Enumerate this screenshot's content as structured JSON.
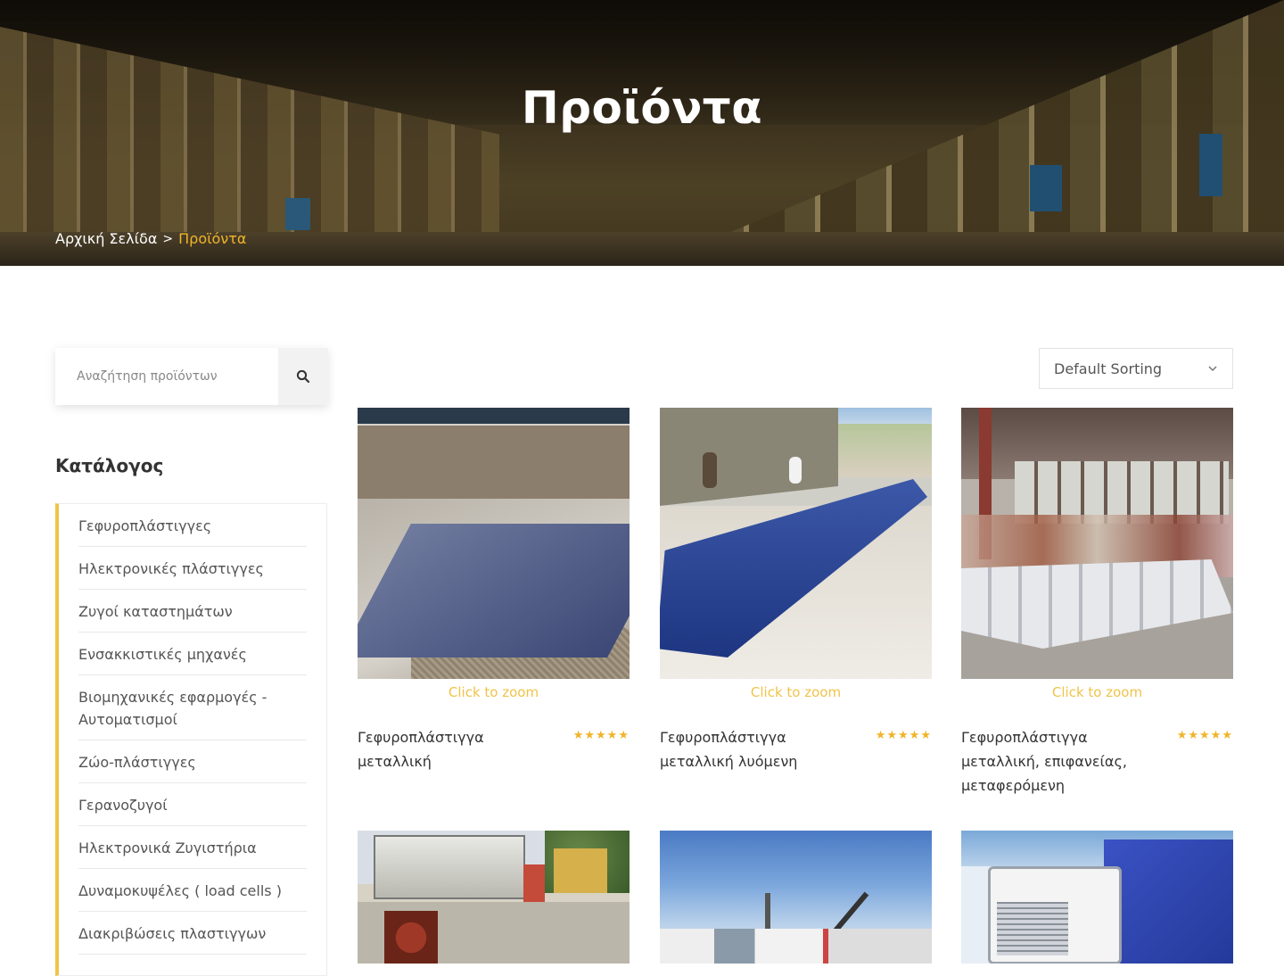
{
  "hero": {
    "title": "Προϊόντα",
    "breadcrumb": {
      "home": "Αρχική Σελίδα",
      "separator": ">",
      "current": "Προϊόντα"
    }
  },
  "search": {
    "placeholder": "Αναζήτηση προϊόντων",
    "icon": "search-icon"
  },
  "catalog": {
    "title": "Κατάλογος",
    "items": [
      "Γεφυροπλάστιγγες",
      "Ηλεκτρονικές πλάστιγγες",
      "Ζυγοί καταστημάτων",
      "Ενσακκιστικές μηχανές",
      "Βιομηχανικές εφαρμογές - Αυτοματισμοί",
      "Ζώο-πλάστιγγες",
      "Γερανοζυγοί",
      "Ηλεκτρονικά Ζυγιστήρια",
      "Δυναμοκυψέλες ( load cells )",
      "Διακριβώσεις πλαστιγγων"
    ]
  },
  "sort": {
    "selected": "Default Sorting",
    "icon": "chevron-down-icon"
  },
  "products": [
    {
      "zoom_label": "Click to zoom",
      "name": "Γεφυροπλάστιγγα μεταλλική",
      "rating": "★★★★★"
    },
    {
      "zoom_label": "Click to zoom",
      "name": "Γεφυροπλάστιγγα μεταλλική λυόμενη",
      "rating": "★★★★★"
    },
    {
      "zoom_label": "Click to zoom",
      "name": "Γεφυροπλάστιγγα μεταλλική, επιφανείας, μεταφερόμενη",
      "rating": "★★★★★"
    }
  ],
  "colors": {
    "accent": "#f0b429",
    "catalog_border": "#f0c34a"
  }
}
